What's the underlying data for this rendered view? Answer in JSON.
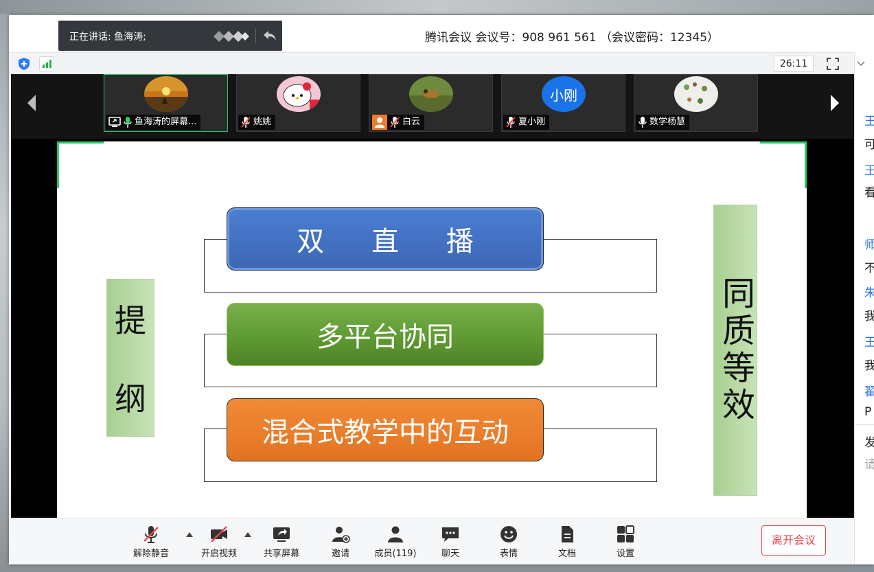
{
  "titlebar": {
    "title": "腾讯会议 会议号：908 961 561 （会议密码：12345）"
  },
  "speaker_toast": {
    "label": "正在讲话: 鱼海涛;"
  },
  "status": {
    "timer": "26:11"
  },
  "participants": [
    {
      "name": "鱼海涛的屏幕...",
      "muted": false,
      "sharing": true,
      "active": true,
      "avatar": "sunset"
    },
    {
      "name": "姚姚",
      "muted": true,
      "avatar": "hello-kitty"
    },
    {
      "name": "白云",
      "muted": true,
      "avatar": "nature",
      "badge": "person"
    },
    {
      "name": "夏小刚",
      "muted": true,
      "avatar": "text",
      "avatar_text": "小刚"
    },
    {
      "name": "数学杨慧",
      "muted": false,
      "avatar": "plants"
    }
  ],
  "slide": {
    "left_box": [
      "提",
      "纲"
    ],
    "right_box": "同质等效",
    "items": [
      {
        "label": "双 直 播",
        "color": "#4472c4"
      },
      {
        "label": "多平台协同",
        "color": "#5f9a33"
      },
      {
        "label": "混合式教学中的互动",
        "color": "#ea7d2a"
      }
    ]
  },
  "bottombar": {
    "unmute": "解除静音",
    "start_video": "开启视频",
    "share_screen": "共享屏幕",
    "invite": "邀请",
    "members": "成员(119)",
    "chat": "聊天",
    "emoji": "表情",
    "docs": "文档",
    "settings": "设置",
    "leave": "离开会议"
  },
  "chat_panel": {
    "lines": [
      {
        "text": "王",
        "kind": "name"
      },
      {
        "text": "可",
        "kind": "msg"
      },
      {
        "text": "王",
        "kind": "name"
      },
      {
        "text": "看",
        "kind": "msg"
      },
      {
        "text": "师",
        "kind": "name"
      },
      {
        "text": "不",
        "kind": "msg"
      },
      {
        "text": "朱",
        "kind": "name"
      },
      {
        "text": "我",
        "kind": "msg"
      },
      {
        "text": "王",
        "kind": "name"
      },
      {
        "text": "我",
        "kind": "msg"
      },
      {
        "text": "翟",
        "kind": "name"
      },
      {
        "text": "P",
        "kind": "msg"
      },
      {
        "text": "发",
        "kind": "msg"
      },
      {
        "text": "请",
        "kind": "hint"
      }
    ]
  },
  "colors": {
    "accent_green": "#1fcf6e",
    "leave_red": "#e5484d",
    "chat_name_blue": "#2a72d9"
  }
}
